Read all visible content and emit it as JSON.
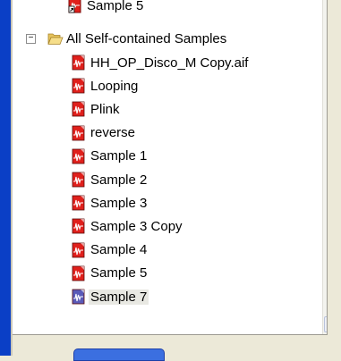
{
  "tree": {
    "top_item": "Sample 5",
    "folder_label": "All Self-contained Samples",
    "files": [
      "HH_OP_Disco_M Copy.aif",
      "Looping",
      "Plink",
      "reverse",
      "Sample 1",
      "Sample 2",
      "Sample 3",
      "Sample 3 Copy",
      "Sample 4",
      "Sample 5",
      "Sample 7"
    ],
    "selected_file": "Sample 7"
  },
  "colors": {
    "file_icon": "#e0201c",
    "selected_file_icon": "#5a5ab8",
    "folder": "#f2d779",
    "window_border": "#0a3fc6"
  }
}
